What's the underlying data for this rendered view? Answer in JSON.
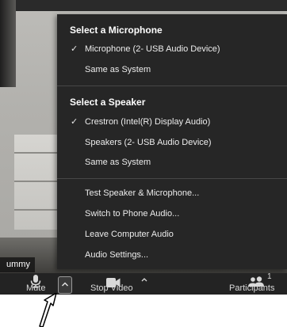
{
  "menu": {
    "microphone_header": "Select a Microphone",
    "microphones": [
      {
        "label": "Microphone (2- USB Audio Device)",
        "checked": true
      },
      {
        "label": "Same as System",
        "checked": false
      }
    ],
    "speaker_header": "Select a Speaker",
    "speakers": [
      {
        "label": "Crestron (Intel(R) Display Audio)",
        "checked": true
      },
      {
        "label": "Speakers (2- USB Audio Device)",
        "checked": false
      },
      {
        "label": "Same as System",
        "checked": false
      }
    ],
    "actions": [
      "Test Speaker & Microphone...",
      "Switch to Phone Audio...",
      "Leave Computer Audio",
      "Audio Settings..."
    ],
    "check_mark": "✓"
  },
  "video": {
    "name_tag": "ummy"
  },
  "toolbar": {
    "mute_label": "Mute",
    "stop_video_label": "Stop Video",
    "participants_label": "Participants",
    "participants_count": "1"
  },
  "colors": {
    "menu_bg": "#262626",
    "toolbar_bg": "#232323",
    "text": "#ececec"
  },
  "icons": {
    "mute": "microphone-icon",
    "audio_options": "chevron-up-icon",
    "video": "video-camera-icon",
    "video_options": "chevron-up-icon",
    "participants": "participants-icon",
    "check": "check-icon"
  }
}
